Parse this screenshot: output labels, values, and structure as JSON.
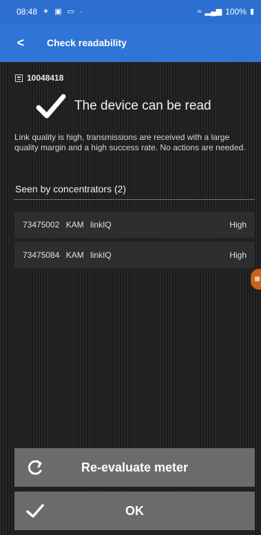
{
  "status_bar": {
    "time": "08:48",
    "left_icons": [
      "notification-icon",
      "media-icon",
      "message-icon",
      "dot-icon"
    ],
    "right_text": "100%",
    "right_icons": [
      "wifi-icon",
      "signal-icon",
      "battery-icon"
    ]
  },
  "app_bar": {
    "back_label": "<",
    "title": "Check readability"
  },
  "device": {
    "id": "10048418",
    "icon": "meter-icon"
  },
  "result": {
    "icon": "check-icon",
    "text": "The device can be read",
    "description": "Link quality is high, transmissions are received with a large quality margin and a high success rate. No actions are needed."
  },
  "concentrators": {
    "title": "Seen by concentrators (2)",
    "rows": [
      {
        "id": "73475002",
        "vendor": "KAM",
        "type": "linkIQ",
        "quality": "High"
      },
      {
        "id": "73475084",
        "vendor": "KAM",
        "type": "linkIQ",
        "quality": "High"
      }
    ]
  },
  "buttons": {
    "reevaluate_label": "Re-evaluate meter",
    "ok_label": "OK"
  },
  "colors": {
    "status_bar": "#2d6fd1",
    "app_bar": "#2f74d6",
    "background": "#1f1f1f",
    "row": "#2e2e2e",
    "button": "#6b6b6b",
    "handle": "#c9621e"
  }
}
